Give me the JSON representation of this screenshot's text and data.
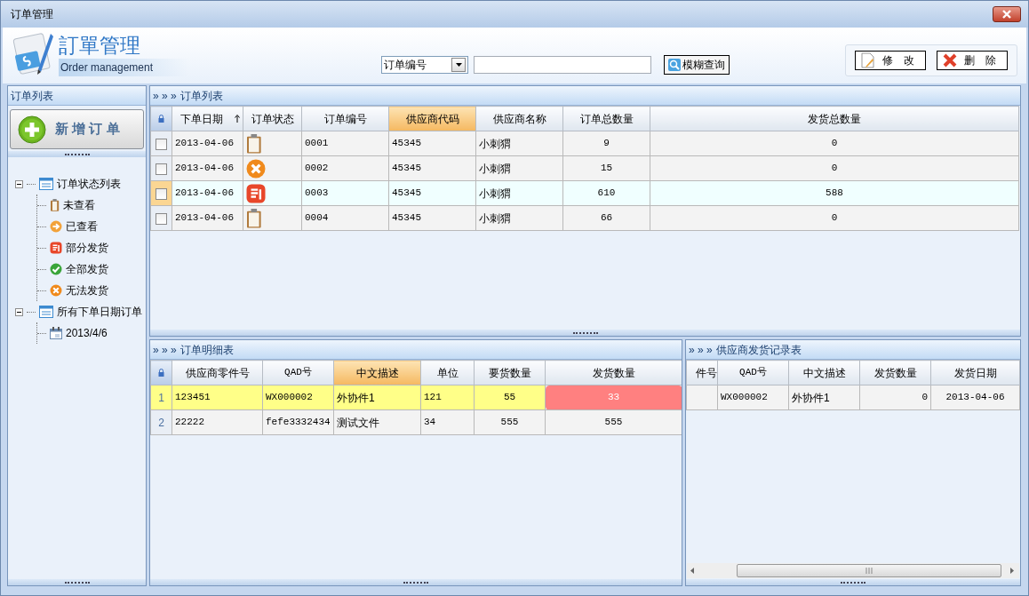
{
  "window": {
    "title": "订单管理"
  },
  "header": {
    "logo_title": "訂單管理",
    "logo_subtitle": "Order management",
    "search_field_select": "订单编号",
    "search_button": "模糊查询",
    "edit_button": "修　改",
    "delete_button": "删　除"
  },
  "sidebar": {
    "title": "订单列表",
    "add_button": "新 增 订 单",
    "tree": [
      {
        "label": "订单状态列表",
        "kind": "list",
        "expanded": true,
        "children": [
          {
            "label": "未查看",
            "kind": "clipboard"
          },
          {
            "label": "已查看",
            "kind": "arrow"
          },
          {
            "label": "部分发货",
            "kind": "partial"
          },
          {
            "label": "全部发货",
            "kind": "check"
          },
          {
            "label": "无法发货",
            "kind": "cross"
          }
        ]
      },
      {
        "label": "所有下单日期订单",
        "kind": "list",
        "expanded": true,
        "children": [
          {
            "label": "2013/4/6",
            "kind": "calendar"
          }
        ]
      }
    ]
  },
  "orders": {
    "marker": "» » »",
    "title": "订单列表",
    "columns": [
      {
        "label": "下单日期",
        "highlighted": false,
        "sorted": true
      },
      {
        "label": "订单状态",
        "highlighted": false,
        "sorted": false
      },
      {
        "label": "订单编号",
        "highlighted": false,
        "sorted": false
      },
      {
        "label": "供应商代码",
        "highlighted": true,
        "sorted": false
      },
      {
        "label": "供应商名称",
        "highlighted": false,
        "sorted": false
      },
      {
        "label": "订单总数量",
        "highlighted": false,
        "sorted": false
      },
      {
        "label": "发货总数量",
        "highlighted": false,
        "sorted": false
      }
    ],
    "rows": [
      {
        "checked": false,
        "selected": false,
        "kind": "clipboard",
        "date": "2013-04-06",
        "number": "0001",
        "code": "45345",
        "supplier": "小刺猬",
        "total": "9",
        "shipped": "0"
      },
      {
        "checked": false,
        "selected": false,
        "kind": "cross",
        "date": "2013-04-06",
        "number": "0002",
        "code": "45345",
        "supplier": "小刺猬",
        "total": "15",
        "shipped": "0"
      },
      {
        "checked": false,
        "selected": true,
        "kind": "partial",
        "date": "2013-04-06",
        "number": "0003",
        "code": "45345",
        "supplier": "小刺猬",
        "total": "610",
        "shipped": "588"
      },
      {
        "checked": false,
        "selected": false,
        "kind": "clipboard",
        "date": "2013-04-06",
        "number": "0004",
        "code": "45345",
        "supplier": "小刺猬",
        "total": "66",
        "shipped": "0"
      }
    ]
  },
  "details": {
    "marker": "» » »",
    "title": "订单明细表",
    "columns": [
      {
        "label": "供应商零件号",
        "highlighted": false
      },
      {
        "label": "QAD号",
        "highlighted": false
      },
      {
        "label": "中文描述",
        "highlighted": true
      },
      {
        "label": "单位",
        "highlighted": false
      },
      {
        "label": "要货数量",
        "highlighted": false
      },
      {
        "label": "发货数量",
        "highlighted": false
      }
    ],
    "rows": [
      {
        "row_number": "1",
        "selected": true,
        "shortfall": true,
        "cells": [
          "123451",
          "WX000002",
          "外协件1",
          "121",
          "55",
          "33"
        ]
      },
      {
        "row_number": "2",
        "selected": false,
        "shortfall": false,
        "cells": [
          "22222",
          "fefe3332434",
          "测试文件",
          "34",
          "555",
          "555"
        ]
      }
    ]
  },
  "shipments": {
    "marker": "» » »",
    "title": "供应商发货记录表",
    "columns": [
      {
        "label": "件号"
      },
      {
        "label": "QAD号"
      },
      {
        "label": "中文描述"
      },
      {
        "label": "发货数量"
      },
      {
        "label": "发货日期"
      }
    ],
    "rows": [
      {
        "cells": [
          "",
          "WX000002",
          "外协件1",
          "0",
          "2013-04-06"
        ]
      }
    ]
  }
}
